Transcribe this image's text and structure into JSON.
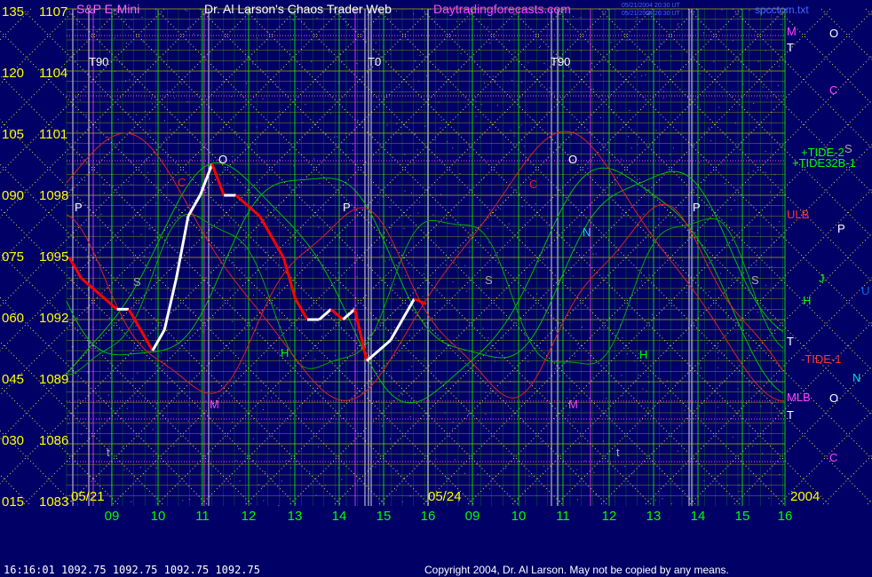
{
  "header": {
    "instrument": "S&P E-Mini",
    "author": "Dr. Al Larson's Chaos Trader Web",
    "site": "Daytradingforecasts.com",
    "stamp1": "05/21/2004 20:30 UT",
    "stamp2": "05/21/2004 20:30 UT",
    "file": "spcctom.txt"
  },
  "footer": {
    "quote": "16:16:01  1092.75 1092.75 1092.75 1092.75",
    "copyright": "Copyright 2004, Dr. Al Larson. May not be copied by any means."
  },
  "colors": {
    "background": "#000066",
    "grid_h": "#b0b000",
    "grid_v": "#00c000",
    "left_axis": "#ffff00",
    "bottom_axis": "#00ff00",
    "price_up": "#ffffff",
    "price_down": "#ff0000",
    "tide": "#00c000",
    "flux_red": "#dd2222",
    "magenta": "#ff44ff"
  },
  "chart_data": {
    "type": "line",
    "title": "S&P E-Mini",
    "left_axis_outer": [
      "135",
      "120",
      "105",
      "090",
      "075",
      "060",
      "045",
      "030",
      "015"
    ],
    "left_axis_inner": [
      "1107",
      "1104",
      "1101",
      "1098",
      "1095",
      "1092",
      "1089",
      "1086",
      "1083"
    ],
    "ylim": [
      1083,
      1107
    ],
    "date_labels": [
      "05/21",
      "05/24"
    ],
    "year_label": "2004",
    "hour_labels": [
      "09",
      "10",
      "11",
      "12",
      "13",
      "14",
      "15",
      "16",
      "09",
      "10",
      "11",
      "12",
      "13",
      "14",
      "15",
      "16"
    ],
    "price_series": {
      "name": "",
      "x": [
        0,
        0.25,
        0.5,
        0.75,
        1.0,
        1.25,
        1.5,
        1.75,
        2.0,
        2.25,
        2.5,
        2.75,
        3.0,
        3.25,
        3.5,
        3.75,
        4.0,
        4.25,
        4.5,
        4.75,
        5.0,
        5.25,
        5.5,
        5.75,
        6.0,
        6.25,
        6.5,
        6.75,
        7.0,
        7.25,
        7.5
      ],
      "y": [
        1095,
        1094,
        1093.5,
        1093,
        1092.5,
        1092.5,
        1091.5,
        1090.5,
        1091.5,
        1094,
        1097,
        1098,
        1099.5,
        1098,
        1098,
        1097.5,
        1097,
        1096,
        1095,
        1093,
        1092,
        1092,
        1092.5,
        1092,
        1092.5,
        1090,
        1090.5,
        1091,
        1092,
        1093,
        1092.75
      ]
    },
    "right_labels": [
      {
        "text": "M",
        "color": "#ff44ff"
      },
      {
        "text": "O",
        "color": "#ffffff"
      },
      {
        "text": "T",
        "color": "#ffffff"
      },
      {
        "text": "C",
        "color": "#ff44ff"
      },
      {
        "text": "+TIDE-2",
        "color": "#00ff00"
      },
      {
        "text": "+TIDE32B-1",
        "color": "#00ff00"
      },
      {
        "text": "S",
        "color": "#aaaaaa"
      },
      {
        "text": "ULB",
        "color": "#ff3333"
      },
      {
        "text": "P",
        "color": "#ffffff"
      },
      {
        "text": "J",
        "color": "#00ff00"
      },
      {
        "text": "H",
        "color": "#00ff00"
      },
      {
        "text": "U",
        "color": "#0066ff"
      },
      {
        "text": "T",
        "color": "#ffffff"
      },
      {
        "text": "-TIDE-1",
        "color": "#ff3333"
      },
      {
        "text": "N",
        "color": "#00dddd"
      },
      {
        "text": "MLB",
        "color": "#ff44ff"
      },
      {
        "text": "O",
        "color": "#ffffff"
      },
      {
        "text": "T",
        "color": "#ffffff"
      },
      {
        "text": "C",
        "color": "#ff44ff"
      }
    ],
    "chart_labels": [
      "T90",
      "T0",
      "T90",
      "O",
      "O",
      "P",
      "P",
      "P",
      "S",
      "S",
      "S",
      "M",
      "M",
      "C",
      "C",
      "N",
      "H",
      "H",
      "t",
      "t"
    ]
  }
}
